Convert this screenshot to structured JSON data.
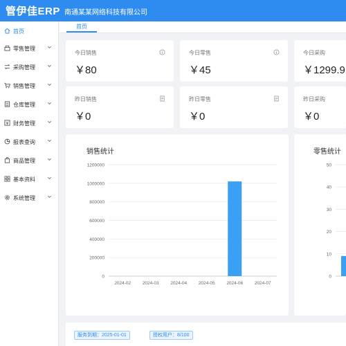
{
  "header": {
    "brand": "管伊佳ERP",
    "company": "南通某某网络科技有限公司",
    "bg_color": "#2e8cf0"
  },
  "sidebar": {
    "items": [
      {
        "label": "首页",
        "icon": "home-icon",
        "active": true
      },
      {
        "label": "零售管理",
        "icon": "register-icon"
      },
      {
        "label": "采购管理",
        "icon": "transfer-icon"
      },
      {
        "label": "销售管理",
        "icon": "cart-icon"
      },
      {
        "label": "仓库管理",
        "icon": "warehouse-icon"
      },
      {
        "label": "财务管理",
        "icon": "finance-icon"
      },
      {
        "label": "报表查询",
        "icon": "pie-chart-icon"
      },
      {
        "label": "商品管理",
        "icon": "shopping-bag-icon"
      },
      {
        "label": "基本资料",
        "icon": "grid-icon"
      },
      {
        "label": "系统管理",
        "icon": "gear-icon"
      }
    ]
  },
  "tabs": {
    "home": "首页"
  },
  "stats": {
    "today_sales_label": "今日销售",
    "today_sales_value": "￥80",
    "today_retail_label": "今日零售",
    "today_retail_value": "￥45",
    "today_purchase_label": "今日采购",
    "today_purchase_value": "￥1299.9",
    "yesterday_sales_label": "昨日销售",
    "yesterday_sales_value": "￥0",
    "yesterday_retail_label": "昨日零售",
    "yesterday_retail_value": "￥0",
    "yesterday_purchase_label": "昨日采购",
    "yesterday_purchase_value": "￥0"
  },
  "chart_data": [
    {
      "type": "bar",
      "title": "销售统计",
      "categories": [
        "2024-02",
        "2024-03",
        "2024-04",
        "2024-05",
        "2024-06",
        "2024-07"
      ],
      "values": [
        0,
        0,
        0,
        0,
        1020000,
        0
      ],
      "ylim": [
        0,
        1200000
      ],
      "yticks": [
        "0",
        "200000",
        "400000",
        "600000",
        "800000",
        "1000000",
        "1200000"
      ],
      "grid": true,
      "color": "#3aa0f3"
    },
    {
      "type": "bar",
      "title": "零售统计",
      "ylim": [
        0,
        50
      ],
      "yticks": [
        "0",
        "10",
        "20",
        "30",
        "40",
        "50"
      ],
      "grid": true,
      "color": "#3aa0f3"
    }
  ],
  "footer": {
    "expiry": "服务到期：2025-01-01",
    "users": "授权用户：8/100"
  }
}
